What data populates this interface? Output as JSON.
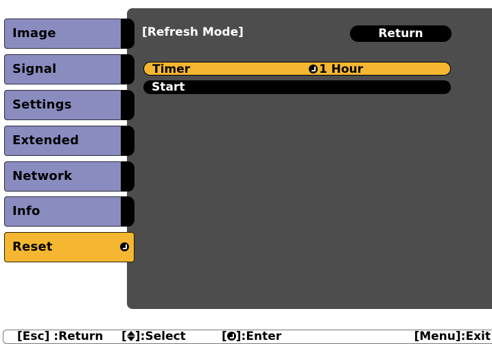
{
  "sidebar": {
    "items": [
      {
        "label": "Image"
      },
      {
        "label": "Signal"
      },
      {
        "label": "Settings"
      },
      {
        "label": "Extended"
      },
      {
        "label": "Network"
      },
      {
        "label": "Info"
      },
      {
        "label": "Reset",
        "active": true
      }
    ]
  },
  "panel": {
    "title": "[Refresh Mode]",
    "return_label": "Return",
    "rows": [
      {
        "label": "Timer",
        "value": "1 Hour",
        "selected": true
      },
      {
        "label": "Start",
        "value": "",
        "selected": false
      }
    ]
  },
  "footer": {
    "esc_hint": "[Esc] :Return",
    "select_hint_prefix": "[",
    "select_hint_suffix": "]:Select",
    "enter_hint_prefix": "[",
    "enter_hint_suffix": "]:Enter",
    "menu_hint": "[Menu]:Exit"
  },
  "colors": {
    "sidebar_item": "#8a8cc0",
    "active_item": "#f5b731",
    "panel_bg": "#4d4d4d",
    "highlight": "#f5b731"
  },
  "icons": {
    "enter": "enter-icon",
    "updown": "up-down-arrow-icon"
  }
}
